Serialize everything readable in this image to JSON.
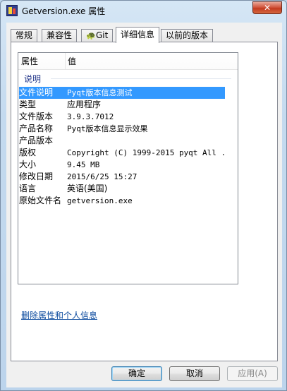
{
  "window": {
    "title": "Getversion.exe 属性",
    "close_glyph": "✕"
  },
  "tabs": [
    {
      "label": "常规"
    },
    {
      "label": "兼容性"
    },
    {
      "label": "Git",
      "icon": "turtle-icon"
    },
    {
      "label": "详细信息",
      "active": true
    },
    {
      "label": "以前的版本"
    }
  ],
  "details": {
    "col_property": "属性",
    "col_value": "值",
    "group_label": "说明",
    "rows": [
      {
        "name": "文件说明",
        "value": "Pyqt版本信息测试",
        "selected": true
      },
      {
        "name": "类型",
        "value": "应用程序"
      },
      {
        "name": "文件版本",
        "value": "3.9.3.7012"
      },
      {
        "name": "产品名称",
        "value": "Pyqt版本信息显示效果"
      },
      {
        "name": "产品版本",
        "value": ""
      },
      {
        "name": "版权",
        "value": "Copyright (C) 1999-2015 pyqt All ..."
      },
      {
        "name": "大小",
        "value": "9.45 MB"
      },
      {
        "name": "修改日期",
        "value": "2015/6/25 15:27"
      },
      {
        "name": "语言",
        "value": "英语(美国)"
      },
      {
        "name": "原始文件名",
        "value": "getversion.exe"
      }
    ]
  },
  "remove_link": "删除属性和个人信息",
  "buttons": {
    "ok": "确定",
    "cancel": "取消",
    "apply": "应用(A)"
  },
  "colors": {
    "selection": "#3399ff",
    "link": "#0b4a9e",
    "group": "#1e3287"
  }
}
